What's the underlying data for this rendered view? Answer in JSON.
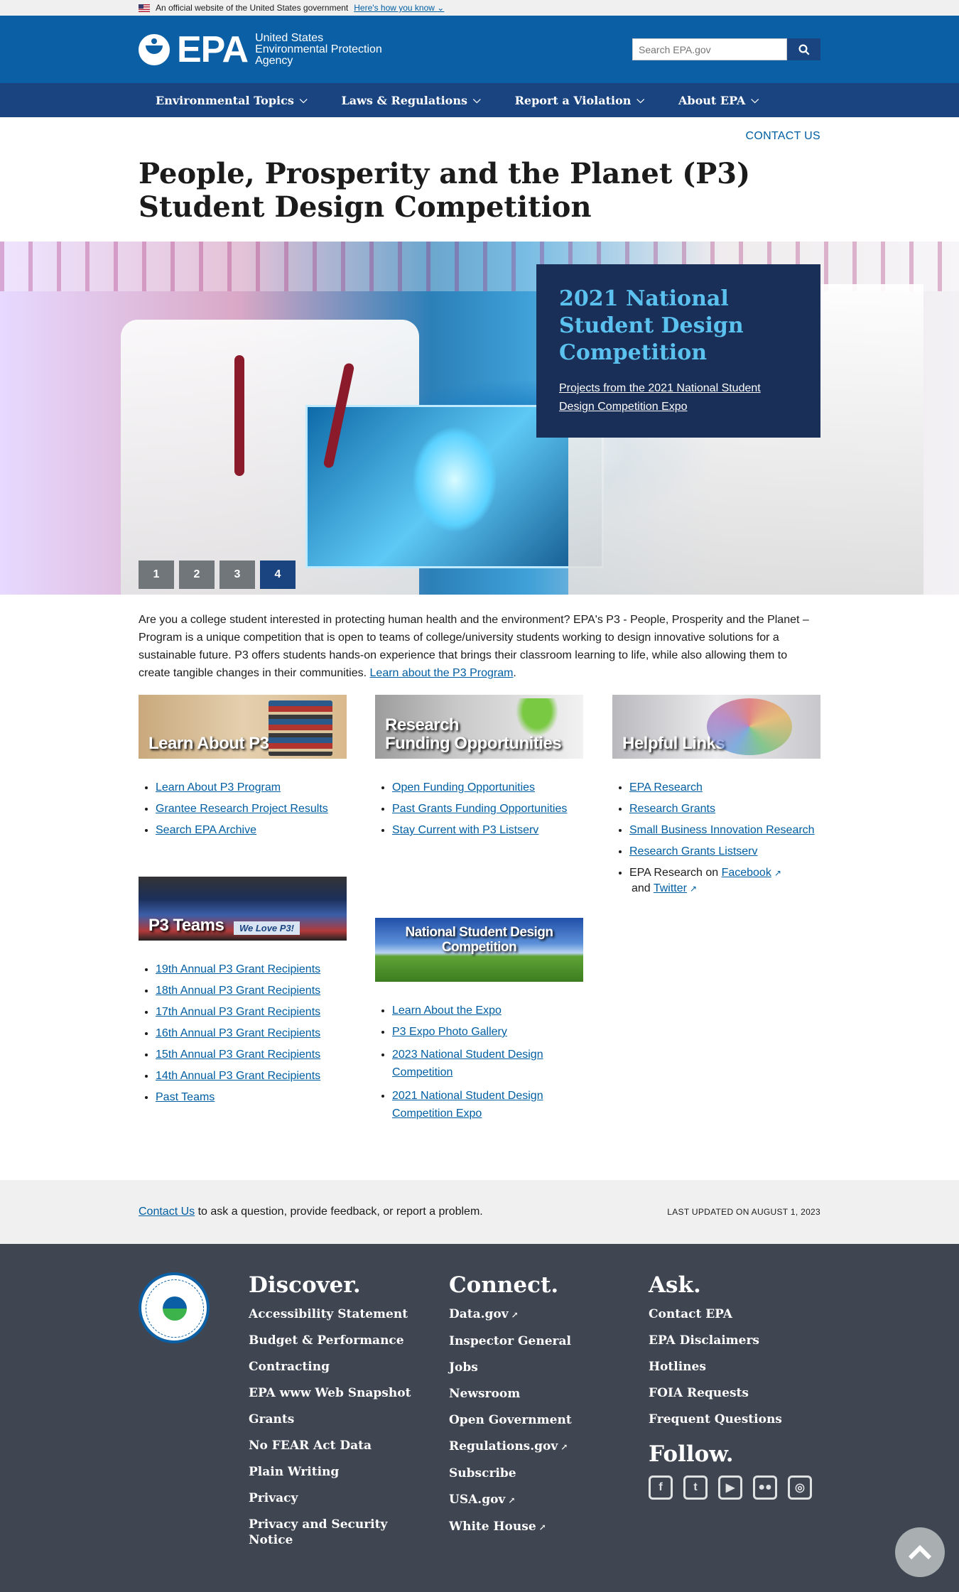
{
  "gov_banner": {
    "text": "An official website of the United States government",
    "link": "Here's how you know"
  },
  "header": {
    "logo_text": "EPA",
    "agency_line1": "United States",
    "agency_line2": "Environmental Protection",
    "agency_line3": "Agency",
    "search_placeholder": "Search EPA.gov",
    "search_button": "search-icon"
  },
  "nav": {
    "items": [
      {
        "label": "Environmental Topics"
      },
      {
        "label": "Laws & Regulations"
      },
      {
        "label": "Report a Violation"
      },
      {
        "label": "About EPA"
      }
    ]
  },
  "page": {
    "contact_link": "CONTACT US",
    "title": "People, Prosperity and the Planet (P3) Student Design Competition"
  },
  "hero": {
    "promo_title": "2021 National Student Design Competition",
    "promo_link": "Projects from the 2021 National Student Design Competition Expo",
    "pages": [
      "1",
      "2",
      "3",
      "4"
    ],
    "active_page": "4"
  },
  "intro": {
    "text": "Are you a college student interested in protecting human health and the environment? EPA's P3 - People, Prosperity and the Planet – Program is a unique competition that is open to teams of college/university students working to design innovative solutions for a sustainable future. P3 offers students hands-on experience that brings their classroom learning to life, while also allowing them to create tangible changes in their communities.",
    "link": "Learn about the P3 Program",
    "end": "."
  },
  "cards": {
    "learn": {
      "image_label": "Learn About P3",
      "links": [
        "Learn About P3 Program",
        "Grantee Research Project Results",
        "Search EPA Archive"
      ]
    },
    "funding": {
      "image_label_1": "Research",
      "image_label_2": "Funding Opportunities",
      "links": [
        "Open Funding Opportunities",
        "Past Grants Funding Opportunities",
        "Stay Current with P3 Listserv"
      ]
    },
    "helpful": {
      "image_label": "Helpful Links",
      "links": [
        "EPA Research",
        "Research Grants",
        "Small Business Innovation Research",
        "Research Grants Listserv"
      ],
      "social_prefix": "EPA Research on",
      "facebook": "Facebook",
      "and": "and",
      "twitter": "Twitter"
    },
    "teams": {
      "image_label": "P3 Teams",
      "image_tag": "We Love P3!",
      "links": [
        "19th Annual P3 Grant Recipients",
        "18th Annual P3 Grant Recipients",
        "17th Annual P3 Grant Recipients",
        "16th Annual P3 Grant Recipients",
        "15th Annual P3 Grant Recipients",
        "14th Annual P3 Grant Recipients",
        "Past Teams"
      ]
    },
    "expo": {
      "image_label_1": "National Student Design",
      "image_label_2": "Competition",
      "links": [
        "Learn About the Expo",
        "P3 Expo Photo Gallery",
        "2023 National Student Design Competition",
        "2021 National Student Design Competition Expo"
      ]
    }
  },
  "feedback": {
    "link": "Contact Us",
    "text": "to ask a question, provide feedback, or report a problem.",
    "updated": "LAST UPDATED ON AUGUST 1, 2023"
  },
  "footer": {
    "discover_title": "Discover.",
    "discover": [
      "Accessibility Statement",
      "Budget & Performance",
      "Contracting",
      "EPA www Web Snapshot",
      "Grants",
      "No FEAR Act Data",
      "Plain Writing",
      "Privacy",
      "Privacy and Security Notice"
    ],
    "connect_title": "Connect.",
    "connect": [
      "Data.gov",
      "Inspector General",
      "Jobs",
      "Newsroom",
      "Open Government",
      "Regulations.gov",
      "Subscribe",
      "USA.gov",
      "White House"
    ],
    "ask_title": "Ask.",
    "ask": [
      "Contact EPA",
      "EPA Disclaimers",
      "Hotlines",
      "FOIA Requests",
      "Frequent Questions"
    ],
    "follow_title": "Follow.",
    "social_icons": [
      "facebook-icon",
      "twitter-icon",
      "youtube-icon",
      "flickr-icon",
      "instagram-icon"
    ]
  }
}
